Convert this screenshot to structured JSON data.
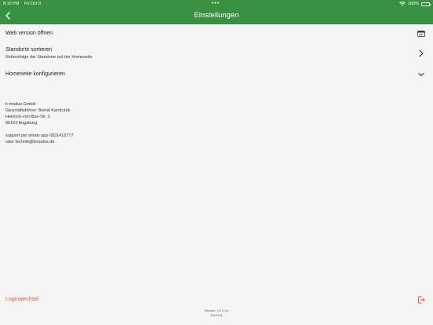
{
  "status_bar": {
    "time": "8:15 PM",
    "date": "Fri Oct 8",
    "dots": "•••",
    "battery": "100%"
  },
  "header": {
    "title": "Einstellungen",
    "background": "#3b9143"
  },
  "settings": {
    "web_version": {
      "label": "Web version öffnen",
      "icon": "browser-window-icon"
    },
    "sort_locations": {
      "label": "Standorte sortieren",
      "sublabel": "Reihenfolge der Standorte auf der Homeseite",
      "icon": "chevron-right-icon"
    },
    "configure_home": {
      "label": "Homeseite konfigurieren",
      "icon": "chevron-down-icon"
    }
  },
  "company": {
    "name": "k-modus GmbH",
    "ceo": "Geschäftsführer: Bernd Karolczyk",
    "street": "Heinrich-von-Buz-Str. 2",
    "city": "86153 Augsburg",
    "support_line": "support per whats app  0821412777",
    "email_line": "oder technik@kmodus.de"
  },
  "logout": {
    "label": "Loginwechsel",
    "color": "#e0543a",
    "icon": "logout-icon"
  },
  "version": {
    "line1": "Version: 1.0.0 (1)",
    "line2": "2023106"
  }
}
